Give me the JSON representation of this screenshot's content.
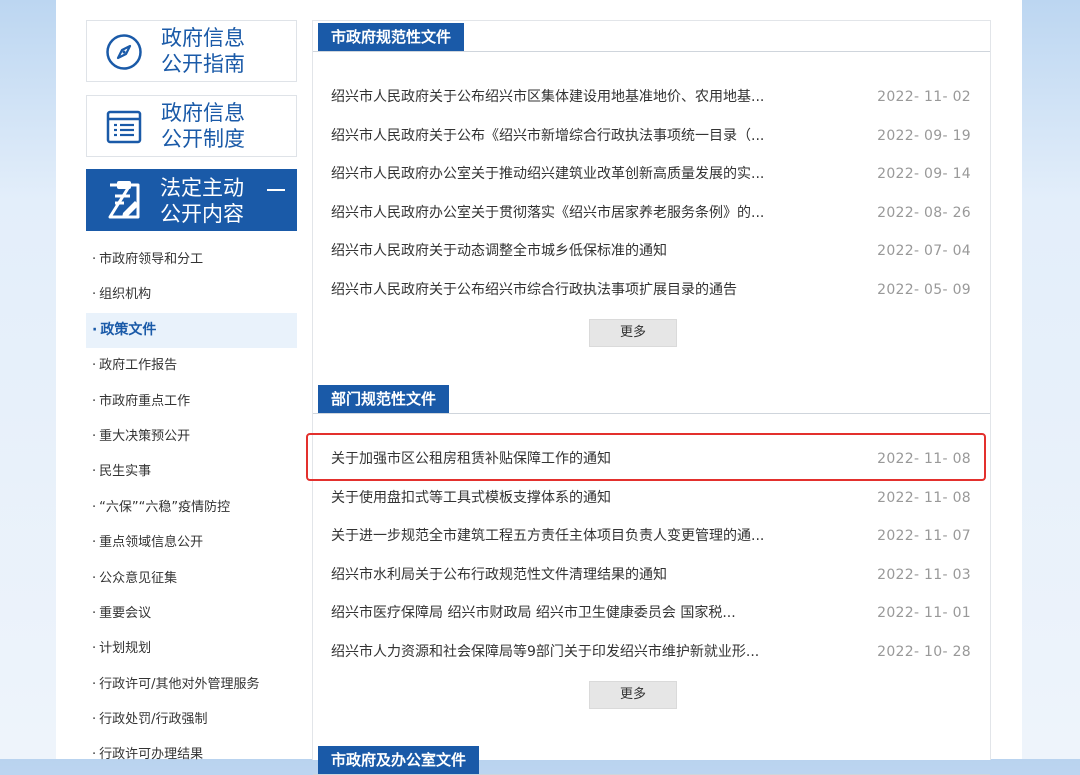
{
  "sidebar": {
    "guide_card": {
      "line1": "政府信息",
      "line2": "公开指南",
      "icon": "compass-icon"
    },
    "system_card": {
      "line1": "政府信息",
      "line2": "公开制度",
      "icon": "document-list-icon"
    },
    "active_card": {
      "line1": "法定主动",
      "line2": "公开内容",
      "icon": "clipboard-edit-icon",
      "toggle": "minus-icon"
    },
    "menu": [
      {
        "label": "市政府领导和分工"
      },
      {
        "label": "组织机构"
      },
      {
        "label": "政策文件",
        "active": true
      },
      {
        "label": "政府工作报告"
      },
      {
        "label": "市政府重点工作"
      },
      {
        "label": "重大决策预公开"
      },
      {
        "label": "民生实事"
      },
      {
        "label": "“六保”“六稳”疫情防控"
      },
      {
        "label": "重点领域信息公开"
      },
      {
        "label": "公众意见征集"
      },
      {
        "label": "重要会议"
      },
      {
        "label": "计划规划"
      },
      {
        "label": "行政许可/其他对外管理服务"
      },
      {
        "label": "行政处罚/行政强制"
      },
      {
        "label": "行政许可办理结果"
      }
    ]
  },
  "sections": [
    {
      "title": "市政府规范性文件",
      "items": [
        {
          "title": "绍兴市人民政府关于公布绍兴市区集体建设用地基准地价、农用地基...",
          "date": "2022- 11- 02"
        },
        {
          "title": "绍兴市人民政府关于公布《绍兴市新增综合行政执法事项统一目录（...",
          "date": "2022- 09- 19"
        },
        {
          "title": "绍兴市人民政府办公室关于推动绍兴建筑业改革创新高质量发展的实...",
          "date": "2022- 09- 14"
        },
        {
          "title": "绍兴市人民政府办公室关于贯彻落实《绍兴市居家养老服务条例》的...",
          "date": "2022- 08- 26"
        },
        {
          "title": "绍兴市人民政府关于动态调整全市城乡低保标准的通知",
          "date": "2022- 07- 04"
        },
        {
          "title": "绍兴市人民政府关于公布绍兴市综合行政执法事项扩展目录的通告",
          "date": "2022- 05- 09"
        }
      ],
      "more": "更多"
    },
    {
      "title": "部门规范性文件",
      "items": [
        {
          "title": "关于加强市区公租房租赁补贴保障工作的通知",
          "date": "2022- 11- 08"
        },
        {
          "title": "关于使用盘扣式等工具式模板支撑体系的通知",
          "date": "2022- 11- 08"
        },
        {
          "title": "关于进一步规范全市建筑工程五方责任主体项目负责人变更管理的通...",
          "date": "2022- 11- 07"
        },
        {
          "title": "绍兴市水利局关于公布行政规范性文件清理结果的通知",
          "date": "2022- 11- 03"
        },
        {
          "title": "绍兴市医疗保障局 绍兴市财政局 绍兴市卫生健康委员会 国家税...",
          "date": "2022- 11- 01"
        },
        {
          "title": "绍兴市人力资源和社会保障局等9部门关于印发绍兴市维护新就业形...",
          "date": "2022- 10- 28"
        }
      ],
      "more": "更多"
    },
    {
      "title": "市政府及办公室文件"
    }
  ],
  "highlight_color": "#e3302d",
  "accent_color": "#1a5aa8"
}
